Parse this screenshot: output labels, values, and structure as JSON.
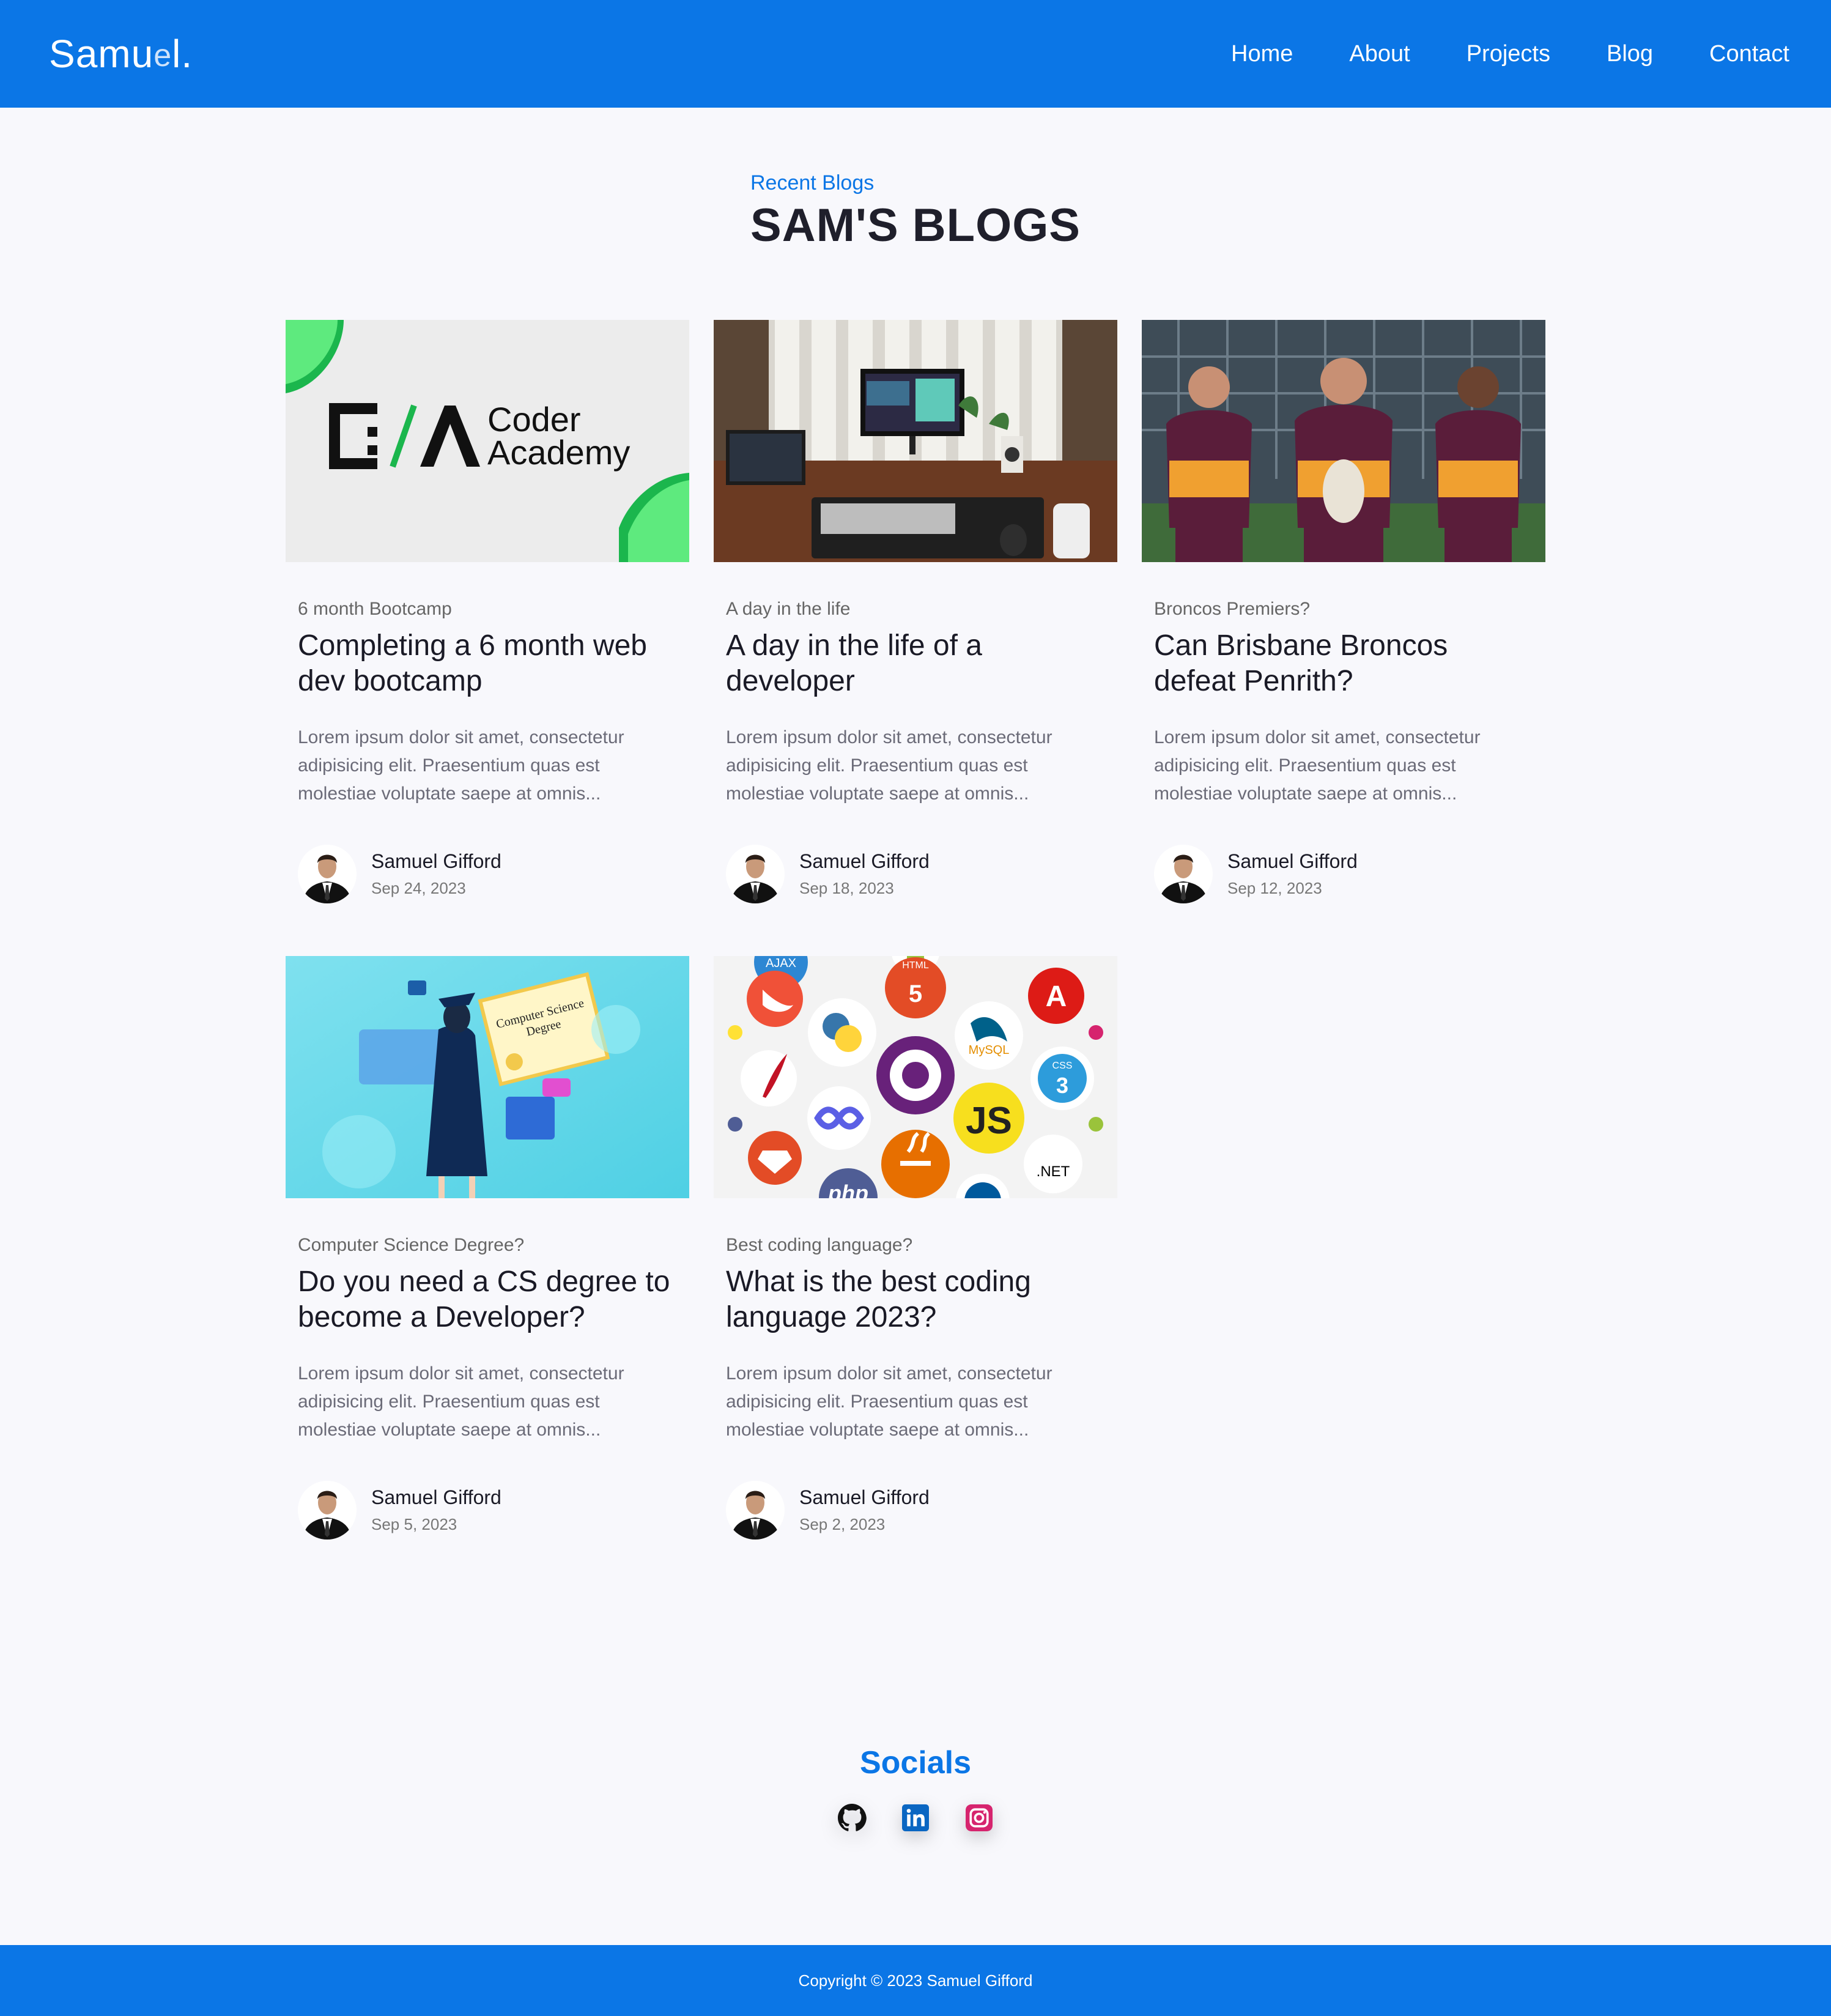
{
  "brand": {
    "prefix": "Samu",
    "mark": "e",
    "suffix": "l."
  },
  "nav": {
    "home": "Home",
    "about": "About",
    "projects": "Projects",
    "blog": "Blog",
    "contact": "Contact"
  },
  "header": {
    "subtitle": "Recent Blogs",
    "title": "SAM'S BLOGS"
  },
  "posts": [
    {
      "category": "6 month Bootcamp",
      "title": "Completing a 6 month web dev bootcamp",
      "excerpt": "Lorem ipsum dolor sit amet, consectetur adipisicing elit. Praesentium quas est molestiae voluptate saepe at omnis...",
      "author": "Samuel Gifford",
      "date": "Sep 24, 2023",
      "image_text": {
        "line1": "Coder",
        "line2": "Academy"
      }
    },
    {
      "category": "A day in the life",
      "title": "A day in the life of a developer",
      "excerpt": "Lorem ipsum dolor sit amet, consectetur adipisicing elit. Praesentium quas est molestiae voluptate saepe at omnis...",
      "author": "Samuel Gifford",
      "date": "Sep 18, 2023"
    },
    {
      "category": "Broncos Premiers?",
      "title": "Can Brisbane Broncos defeat Penrith?",
      "excerpt": "Lorem ipsum dolor sit amet, consectetur adipisicing elit. Praesentium quas est molestiae voluptate saepe at omnis...",
      "author": "Samuel Gifford",
      "date": "Sep 12, 2023"
    },
    {
      "category": "Computer Science Degree?",
      "title": "Do you need a CS degree to become a Developer?",
      "excerpt": "Lorem ipsum dolor sit amet, consectetur adipisicing elit. Praesentium quas est molestiae voluptate saepe at omnis...",
      "author": "Samuel Gifford",
      "date": "Sep 5, 2023",
      "image_text": {
        "cert1": "Computer Science",
        "cert2": "Degree"
      }
    },
    {
      "category": "Best coding language?",
      "title": "What is the best coding language 2023?",
      "excerpt": "Lorem ipsum dolor sit amet, consectetur adipisicing elit. Praesentium quas est molestiae voluptate saepe at omnis...",
      "author": "Samuel Gifford",
      "date": "Sep 2, 2023",
      "image_text": {
        "js": "JS",
        "mysql": "MySQL",
        "html": "HTML",
        "css": "CSS",
        "net": ".NET",
        "ajax": "AJAX",
        "php": "php"
      }
    }
  ],
  "socials": {
    "title": "Socials",
    "icons": [
      "github-icon",
      "linkedin-icon",
      "instagram-icon"
    ]
  },
  "footer": {
    "copyright": "Copyright © 2023 Samuel Gifford"
  },
  "colors": {
    "primary": "#0b76e6",
    "background": "#f8f8fc",
    "linkedin": "#0a66c2",
    "instagram": "#d6246e"
  }
}
